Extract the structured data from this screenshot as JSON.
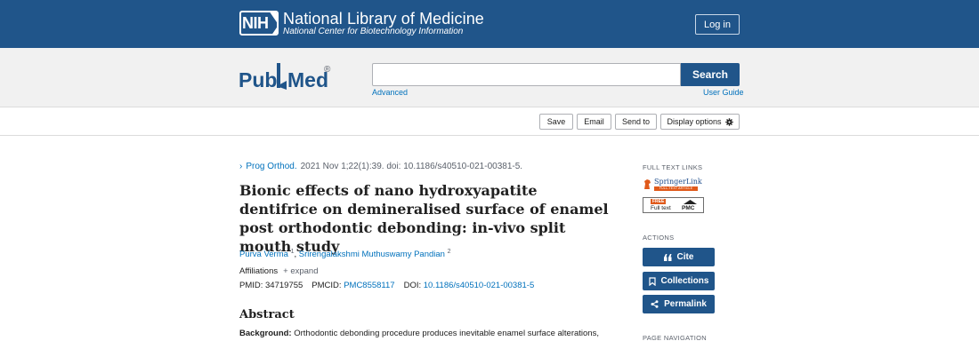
{
  "header": {
    "logo_text": "NIH",
    "org_title": "National Library of Medicine",
    "org_subtitle": "National Center for Biotechnology Information",
    "login_label": "Log in"
  },
  "search": {
    "logo_pub": "Pub",
    "logo_med": "Med",
    "logo_reg": "®",
    "query": "",
    "button_label": "Search",
    "advanced_label": "Advanced",
    "user_guide_label": "User Guide"
  },
  "toolbar": {
    "save_label": "Save",
    "email_label": "Email",
    "send_label": "Send to",
    "display_label": "Display options"
  },
  "article": {
    "journal": "Prog Orthod.",
    "citation_rest": "2021 Nov 1;22(1):39. doi: 10.1186/s40510-021-00381-5.",
    "title": "Bionic effects of nano hydroxyapatite dentifrice on demineralised surface of enamel post orthodontic debonding: in-vivo split mouth study",
    "authors": [
      {
        "name": "Purva Verma",
        "sup": "1"
      },
      {
        "name": "Srirengalakshmi Muthuswamy Pandian",
        "sup": "2"
      }
    ],
    "affiliations_label": "Affiliations",
    "expand_label": "+ expand",
    "pmid_label": "PMID: 34719755",
    "pmcid_label": "PMCID:",
    "pmcid_value": "PMC8558117",
    "doi_label": "DOI:",
    "doi_value": "10.1186/s40510-021-00381-5",
    "abstract_heading": "Abstract",
    "abstract_bg_label": "Background:",
    "abstract_bg_text": "Orthodontic debonding procedure produces inevitable enamel surface alterations,"
  },
  "sidebar": {
    "full_text_heading": "FULL TEXT LINKS",
    "springer_name": "SpringerLink",
    "springer_tag": "FULL-TEXT ARTICLE",
    "pmc_free": "FREE",
    "pmc_full": "Full text",
    "pmc_label": "PMC",
    "actions_heading": "ACTIONS",
    "cite_label": "Cite",
    "collections_label": "Collections",
    "permalink_label": "Permalink",
    "page_nav_heading": "PAGE NAVIGATION"
  },
  "colors": {
    "brand_blue": "#20558a",
    "link_blue": "#0071bc",
    "springer_orange": "#e05a1b"
  }
}
